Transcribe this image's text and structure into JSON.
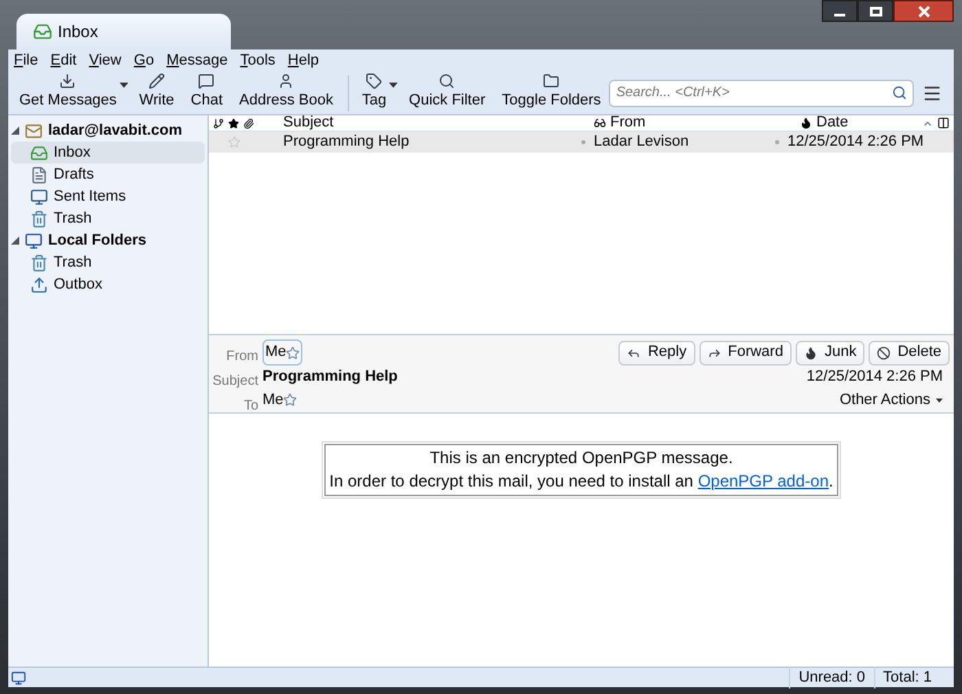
{
  "window": {
    "tab": "Inbox"
  },
  "menu": [
    "File",
    "Edit",
    "View",
    "Go",
    "Message",
    "Tools",
    "Help"
  ],
  "toolbar": [
    {
      "kind": "get",
      "label": "Get Messages",
      "dropdown": true
    },
    {
      "kind": "write",
      "label": "Write",
      "dropdown": false
    },
    {
      "kind": "chat",
      "label": "Chat",
      "dropdown": false
    },
    {
      "kind": "contacts",
      "label": "Address Book",
      "dropdown": false
    },
    {
      "kind": "tag",
      "label": "Tag",
      "dropdown": true
    },
    {
      "kind": "filter",
      "label": "Quick Filter",
      "dropdown": false
    },
    {
      "kind": "folders",
      "label": "Toggle Folders",
      "dropdown": false
    }
  ],
  "search": {
    "placeholder": "Search... <Ctrl+K>"
  },
  "folders": [
    {
      "kind": "account",
      "label": "ladar@lavabit.com",
      "expanded": true,
      "selected": false,
      "children": [
        {
          "kind": "inbox",
          "label": "Inbox",
          "selected": true
        },
        {
          "kind": "drafts",
          "label": "Drafts",
          "selected": false
        },
        {
          "kind": "sent",
          "label": "Sent Items",
          "selected": false
        },
        {
          "kind": "trash",
          "label": "Trash",
          "selected": false
        }
      ]
    },
    {
      "kind": "local",
      "label": "Local Folders",
      "expanded": true,
      "selected": false,
      "children": [
        {
          "kind": "trash",
          "label": "Trash",
          "selected": false
        },
        {
          "kind": "outbox",
          "label": "Outbox",
          "selected": false
        }
      ]
    }
  ],
  "thread_columns": {
    "subject": "Subject",
    "from": "From",
    "date": "Date"
  },
  "messages": [
    {
      "starred": false,
      "subject": "Programming Help",
      "from": "Ladar Levison",
      "date": "12/25/2014 2:26 PM",
      "selected": true
    }
  ],
  "header": {
    "from_label": "From",
    "from": "Me",
    "subject_label": "Subject",
    "subject": "Programming Help",
    "to_label": "To",
    "to": "Me",
    "date": "12/25/2014 2:26 PM",
    "other_actions": "Other Actions",
    "actions": [
      {
        "kind": "reply",
        "label": "Reply"
      },
      {
        "kind": "forward",
        "label": "Forward"
      },
      {
        "kind": "junk",
        "label": "Junk"
      },
      {
        "kind": "delete",
        "label": "Delete"
      }
    ]
  },
  "body": {
    "line1": "This is an encrypted OpenPGP message.",
    "line2": "In order to decrypt this mail, you need to install an ",
    "link": "OpenPGP add-on",
    "end": "."
  },
  "status": {
    "unread": "Unread: 0",
    "total": "Total: 1"
  }
}
